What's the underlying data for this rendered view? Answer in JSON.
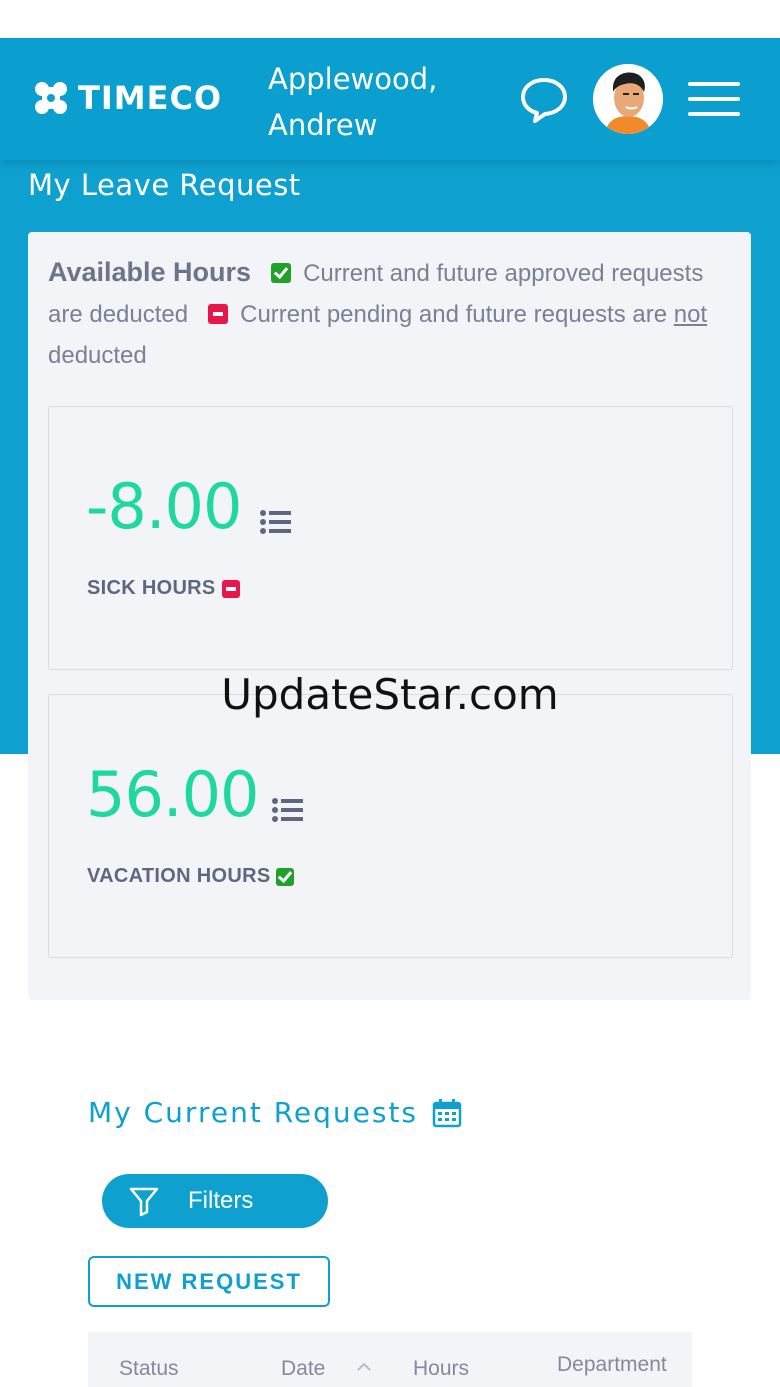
{
  "header": {
    "logo_text": "TIMECO",
    "user_name": "Applewood, Andrew",
    "icons": [
      "chat-icon",
      "avatar",
      "menu-icon"
    ]
  },
  "page": {
    "title": "My Leave Request"
  },
  "available": {
    "heading": "Available Hours",
    "approved_text": "Current and future approved requests are deducted",
    "pending_text_a": "Current pending and future requests are",
    "pending_not": "not",
    "pending_text_b": "deducted"
  },
  "balances": [
    {
      "value": "-8.00",
      "label": "SICK HOURS",
      "status": "pending"
    },
    {
      "value": "56.00",
      "label": "VACATION HOURS",
      "status": "approved"
    }
  ],
  "watermark": "UpdateStar.com",
  "requests": {
    "title": "My Current Requests",
    "filters_label": "Filters",
    "new_request_label": "NEW REQUEST",
    "columns": [
      "Status",
      "Date",
      "Hours",
      "Department"
    ]
  },
  "colors": {
    "brand_blue": "#0ea1d0",
    "value_green": "#1fd8a0",
    "approved_green": "#22a12a",
    "pending_red": "#e8174b"
  }
}
